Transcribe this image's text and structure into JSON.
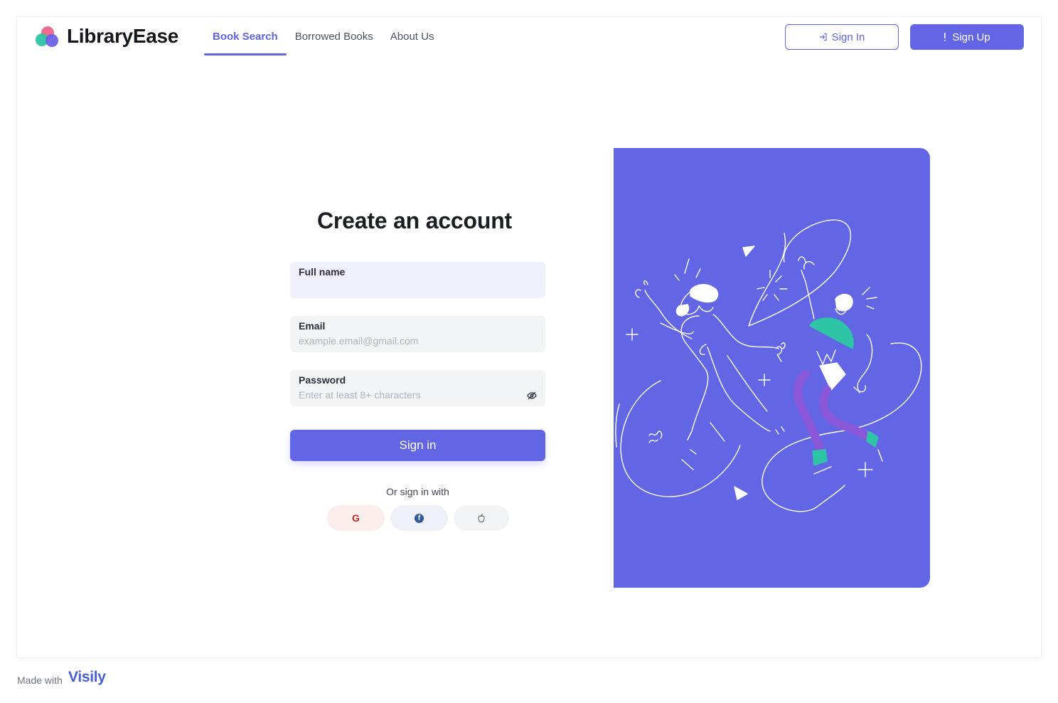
{
  "app": {
    "brand": "LibraryEase"
  },
  "nav": {
    "items": [
      {
        "label": "Book Search",
        "active": true
      },
      {
        "label": "Borrowed Books",
        "active": false
      },
      {
        "label": "About Us",
        "active": false
      }
    ]
  },
  "header_actions": {
    "sign_in_label": "Sign In",
    "sign_up_label": "Sign Up"
  },
  "form": {
    "title": "Create an account",
    "full_name": {
      "label": "Full name",
      "value": "",
      "placeholder": ""
    },
    "email": {
      "label": "Email",
      "value": "",
      "placeholder": "example.email@gmail.com"
    },
    "password": {
      "label": "Password",
      "value": "",
      "placeholder": "Enter at least 8+ characters"
    },
    "submit_label": "Sign in",
    "or_text": "Or sign in with",
    "social": {
      "google": "G"
    }
  },
  "footer": {
    "made_with": "Made with",
    "brand": "Visily"
  },
  "colors": {
    "accent": "#6366e4",
    "illustration_bg": "#6366e4",
    "teal": "#2ec4a6",
    "purple": "#8b57d9"
  },
  "icons": [
    "logo-icon",
    "sign-in-icon",
    "sign-up-icon",
    "eye-off-icon",
    "google-icon",
    "facebook-icon",
    "apple-icon"
  ]
}
